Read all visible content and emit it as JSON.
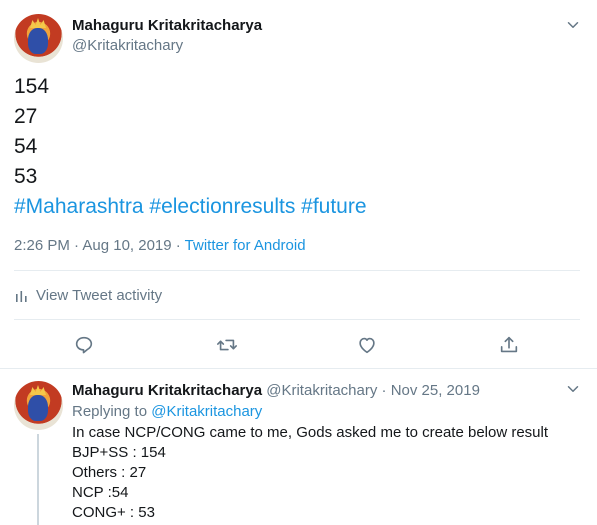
{
  "main_tweet": {
    "author_name": "Mahaguru Kritakritacharya",
    "author_handle": "@Kritakritachary",
    "lines": [
      "154",
      "27",
      "54",
      "53"
    ],
    "hashtags": "#Maharashtra #electionresults #future",
    "timestamp": "2:26 PM · Aug 10, 2019 · ",
    "source": "Twitter for Android",
    "activity_label": "View Tweet activity"
  },
  "reply_tweet": {
    "author_name": "Mahaguru Kritakritacharya",
    "author_handle": "@Kritakritachary",
    "date": "Nov 25, 2019",
    "replying_prefix": "Replying to ",
    "replying_to": "@Kritakritachary",
    "lines": [
      "In case NCP/CONG came to me, Gods asked me to create below result",
      "BJP+SS : 154",
      "Others : 27",
      "NCP :54",
      "CONG+ : 53"
    ]
  },
  "icons": {
    "caret": "chevron-down-icon",
    "activity": "bar-chart-icon",
    "reply": "reply-icon",
    "retweet": "retweet-icon",
    "like": "heart-icon",
    "share": "share-icon"
  }
}
